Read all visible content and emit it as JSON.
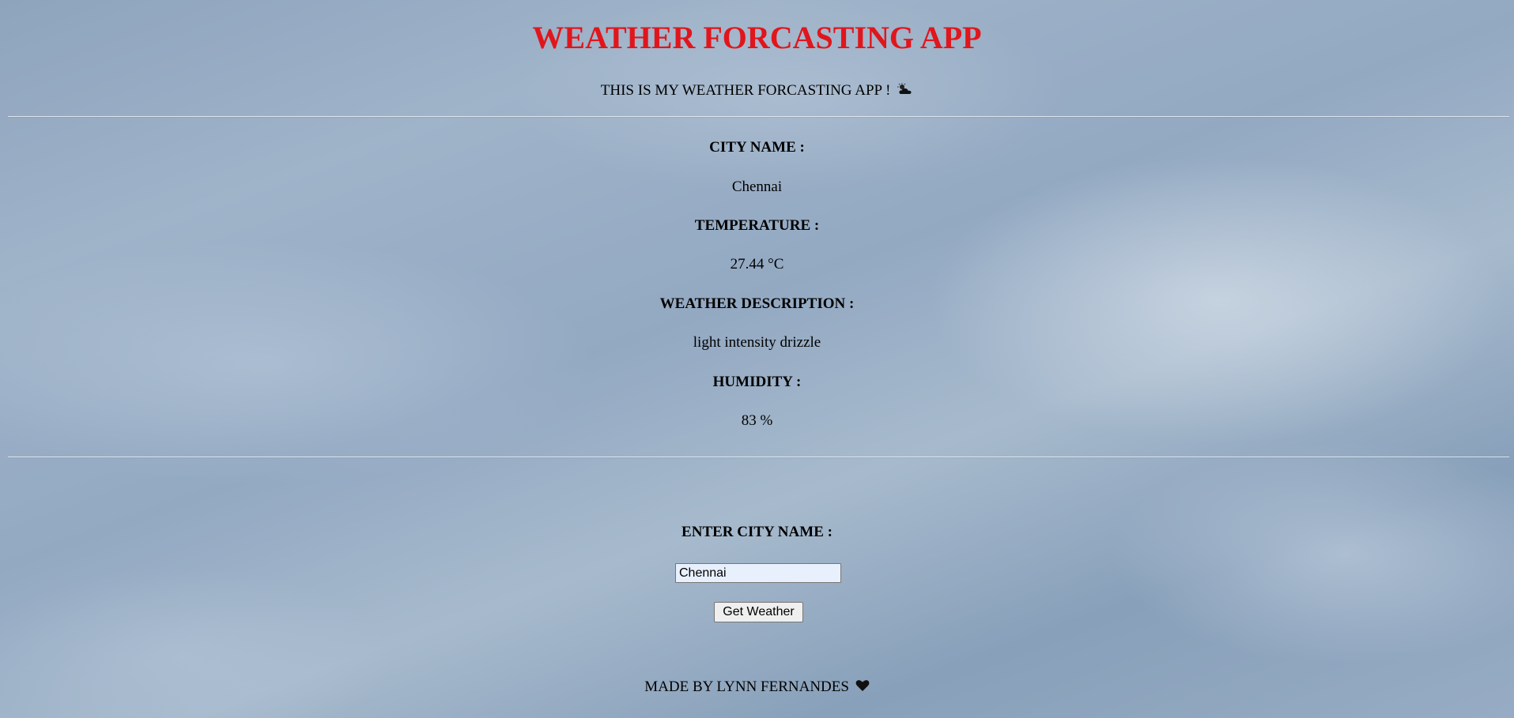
{
  "header": {
    "title": "WEATHER FORCASTING APP",
    "subtitle": "THIS IS MY WEATHER FORCASTING APP !",
    "subtitle_icon": "sun-behind-cloud-icon",
    "title_color": "#e0161c"
  },
  "results": {
    "city_label": "CITY NAME :",
    "city_value": "Chennai",
    "temperature_label": "TEMPERATURE :",
    "temperature_value": "27.44 °C",
    "description_label": "WEATHER DESCRIPTION :",
    "description_value": "light intensity drizzle",
    "humidity_label": "HUMIDITY :",
    "humidity_value": "83 %"
  },
  "form": {
    "city_input_label": "ENTER CITY NAME :",
    "city_input_value": "Chennai",
    "submit_label": "Get Weather"
  },
  "footer": {
    "credit": "MADE BY LYNN FERNANDES",
    "credit_icon": "black-heart-icon"
  }
}
